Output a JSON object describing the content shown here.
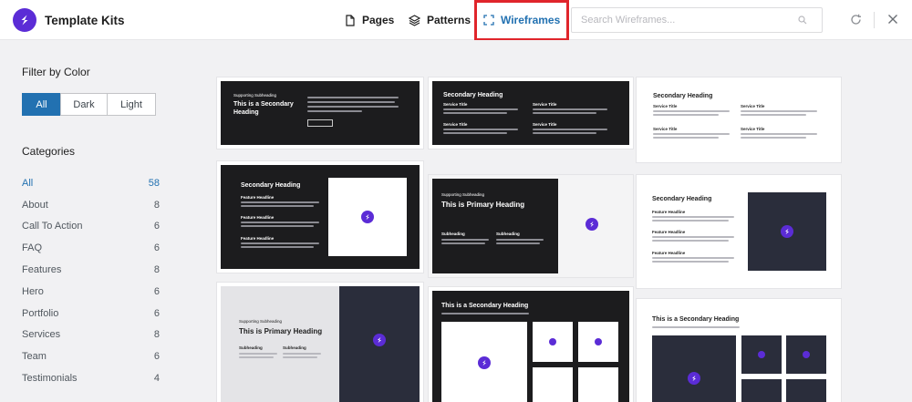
{
  "header": {
    "brand": "Template Kits",
    "tabs": {
      "pages": "Pages",
      "patterns": "Patterns",
      "wireframes": "Wireframes"
    },
    "search_placeholder": "Search Wireframes..."
  },
  "sidebar": {
    "filter_title": "Filter by Color",
    "color_filters": [
      "All",
      "Dark",
      "Light"
    ],
    "categories_title": "Categories",
    "categories": [
      {
        "label": "All",
        "count": "58"
      },
      {
        "label": "About",
        "count": "8"
      },
      {
        "label": "Call To Action",
        "count": "6"
      },
      {
        "label": "FAQ",
        "count": "6"
      },
      {
        "label": "Features",
        "count": "8"
      },
      {
        "label": "Hero",
        "count": "6"
      },
      {
        "label": "Portfolio",
        "count": "6"
      },
      {
        "label": "Services",
        "count": "8"
      },
      {
        "label": "Team",
        "count": "6"
      },
      {
        "label": "Testimonials",
        "count": "4"
      }
    ]
  },
  "cards": {
    "c1": {
      "sub": "Supporting Subheading",
      "title": "This is a Secondary Heading"
    },
    "c2": {
      "title": "Secondary Heading",
      "service": "Service Title"
    },
    "c3": {
      "title": "Secondary Heading",
      "service": "Service Title"
    },
    "c4": {
      "title": "Secondary Heading",
      "feature": "Feature Headline"
    },
    "c5": {
      "sub": "Supporting Subheading",
      "title": "This is Primary Heading",
      "subhead": "Subheading"
    },
    "c6": {
      "title": "Secondary Heading",
      "feature": "Feature Headline"
    },
    "c7": {
      "sub": "Supporting Subheading",
      "title": "This is Primary Heading",
      "subhead": "Subheading"
    },
    "c8": {
      "title": "This is a Secondary Heading"
    },
    "c9": {
      "title": "This is a Secondary Heading"
    }
  },
  "colors": {
    "accent": "#2271b1",
    "brand": "#5b2cd6",
    "highlight": "#e0252b",
    "dark": "#1c1c1e",
    "navy": "#2a2d3b"
  }
}
